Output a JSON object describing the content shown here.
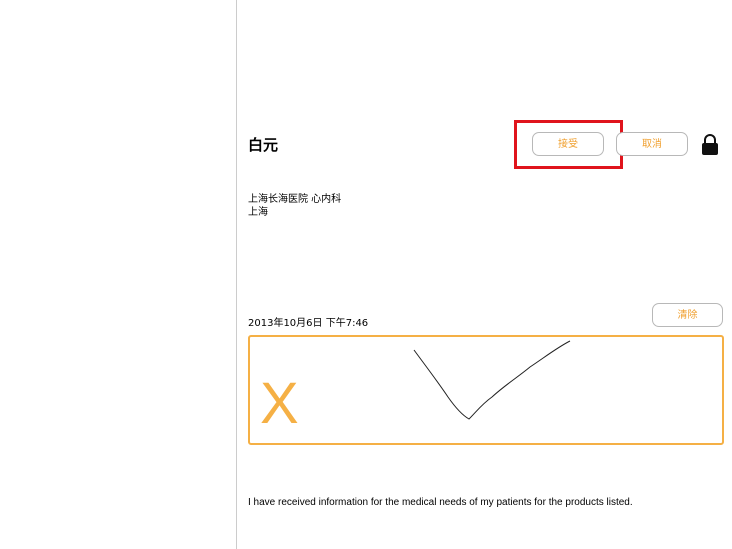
{
  "doctor": {
    "name": "白元",
    "hospital": "上海长海医院 心内科",
    "city": "上海"
  },
  "actions": {
    "accept_label": "接受",
    "cancel_label": "取消",
    "lock_icon": "lock-icon"
  },
  "signature": {
    "timestamp": "2013年10月6日 下午7:46",
    "clear_label": "清除",
    "x_mark": "X"
  },
  "disclaimer": "I have received information for the medical needs of my patients for the products listed.",
  "colors": {
    "accent": "#f0a030",
    "signature_border": "#f5b045",
    "highlight": "#e0141c"
  }
}
